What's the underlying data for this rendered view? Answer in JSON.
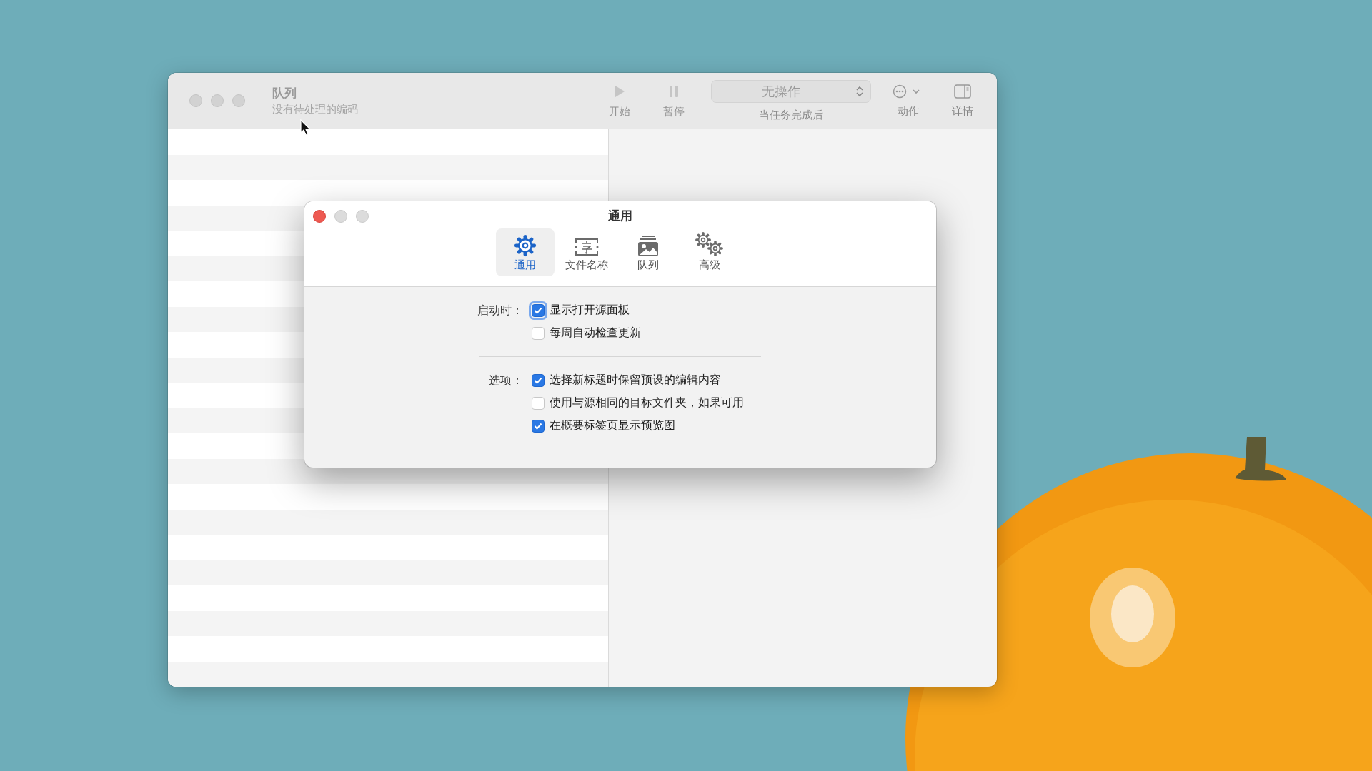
{
  "main_window": {
    "title": "队列",
    "subtitle": "没有待处理的编码",
    "toolbar": [
      {
        "kind": "start",
        "label": "开始",
        "disabled": true
      },
      {
        "kind": "pause",
        "label": "暂停",
        "disabled": true
      },
      {
        "kind": "popup",
        "value": "无操作",
        "label": "当任务完成后"
      },
      {
        "kind": "action",
        "label": "动作"
      },
      {
        "kind": "details",
        "label": "详情"
      }
    ]
  },
  "dialog": {
    "title": "通用",
    "tabs": [
      {
        "kind": "gear",
        "label": "通用",
        "selected": true
      },
      {
        "kind": "name",
        "label": "文件名称",
        "selected": false
      },
      {
        "kind": "queue",
        "label": "队列",
        "selected": false
      },
      {
        "kind": "gears",
        "label": "高级",
        "selected": false
      }
    ],
    "sections": [
      {
        "label": "启动时：",
        "options": [
          {
            "label": "显示打开源面板",
            "checked": true,
            "focused": true
          },
          {
            "label": "每周自动检查更新",
            "checked": false,
            "focused": false
          }
        ]
      },
      {
        "label": "选项：",
        "options": [
          {
            "label": "选择新标题时保留预设的编辑内容",
            "checked": true,
            "focused": false
          },
          {
            "label": "使用与源相同的目标文件夹，如果可用",
            "checked": false,
            "focused": false
          },
          {
            "label": "在概要标签页显示预览图",
            "checked": true,
            "focused": false
          }
        ]
      }
    ]
  }
}
